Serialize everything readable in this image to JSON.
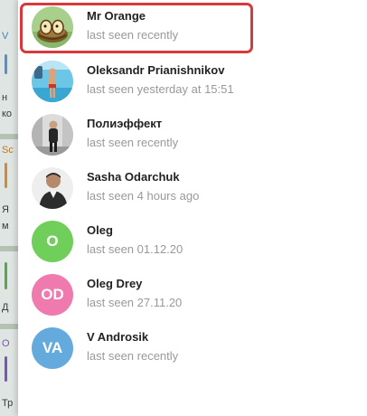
{
  "background_window": {
    "fragments": [
      "V",
      "н",
      "ко",
      "Sc",
      "Я",
      "м",
      "Д",
      "О",
      "Тр"
    ]
  },
  "contacts": [
    {
      "name": "Mr Orange",
      "status": "last seen recently",
      "avatar_type": "photo",
      "avatar_icon": "egg-nest-photo",
      "highlighted": true
    },
    {
      "name": "Oleksandr Prianishnikov",
      "status": "last seen yesterday at 15:51",
      "avatar_type": "photo",
      "avatar_icon": "pool-photo"
    },
    {
      "name": "Полиэффект",
      "status": "last seen recently",
      "avatar_type": "photo",
      "avatar_icon": "person-street-photo"
    },
    {
      "name": "Sasha Odarchuk",
      "status": "last seen 4 hours ago",
      "avatar_type": "photo",
      "avatar_icon": "person-portrait-photo"
    },
    {
      "name": "Oleg",
      "status": "last seen 01.12.20",
      "avatar_type": "initials",
      "initials": "O",
      "color": "#6fcf5a"
    },
    {
      "name": "Oleg Drey",
      "status": "last seen 27.11.20",
      "avatar_type": "initials",
      "initials": "OD",
      "color": "#ee7aae"
    },
    {
      "name": "V Androsik",
      "status": "last seen recently",
      "avatar_type": "initials",
      "initials": "VA",
      "color": "#65aadd"
    }
  ],
  "colors": {
    "highlight_border": "#d8393c",
    "name_text": "#222222",
    "status_text": "#999999"
  }
}
